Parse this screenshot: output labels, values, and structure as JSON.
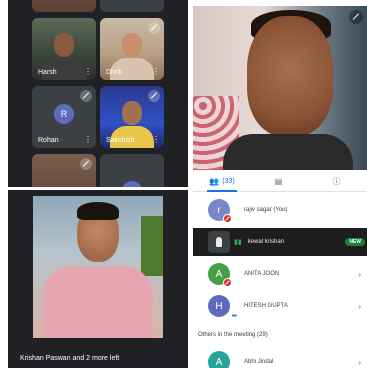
{
  "grid": {
    "tiles": [
      {
        "name": "Harsh"
      },
      {
        "name": "Dhriti"
      },
      {
        "name": "Rohan",
        "avatar_letter": "R",
        "avatar_color": "#5c6bc0"
      },
      {
        "name": "Sakshish"
      }
    ],
    "mute_icon": "mic-off-icon",
    "menu_icon": "more-vert-icon"
  },
  "self_view": {
    "caption": "Krishan Paswan and 2 more left"
  },
  "people_panel": {
    "tabs": [
      {
        "label": "(33)",
        "icon": "people-icon"
      },
      {
        "label": "",
        "icon": "chat-icon"
      },
      {
        "label": "",
        "icon": "info-icon"
      }
    ],
    "participants": [
      {
        "letter": "r",
        "name": "rajiv sagar (You)",
        "color": "#7986cb",
        "muted": true
      },
      {
        "letter": "",
        "name": "kewal krishan",
        "color": "#3c4043",
        "badge": "NEW",
        "speaking": true
      },
      {
        "letter": "A",
        "name": "ANITA JOON",
        "color": "#43a047",
        "muted": true
      },
      {
        "letter": "H",
        "name": "HITESH GUPTA",
        "color": "#5c6bc0",
        "muted": false
      }
    ],
    "others_header": "Others in the meeting (29)",
    "others": [
      {
        "letter": "A",
        "name": "Abhi Jindal",
        "color": "#26a69a"
      }
    ]
  },
  "colors": {
    "accent": "#1a73e8",
    "muted": "#d93025",
    "dark_bg": "#202124"
  }
}
